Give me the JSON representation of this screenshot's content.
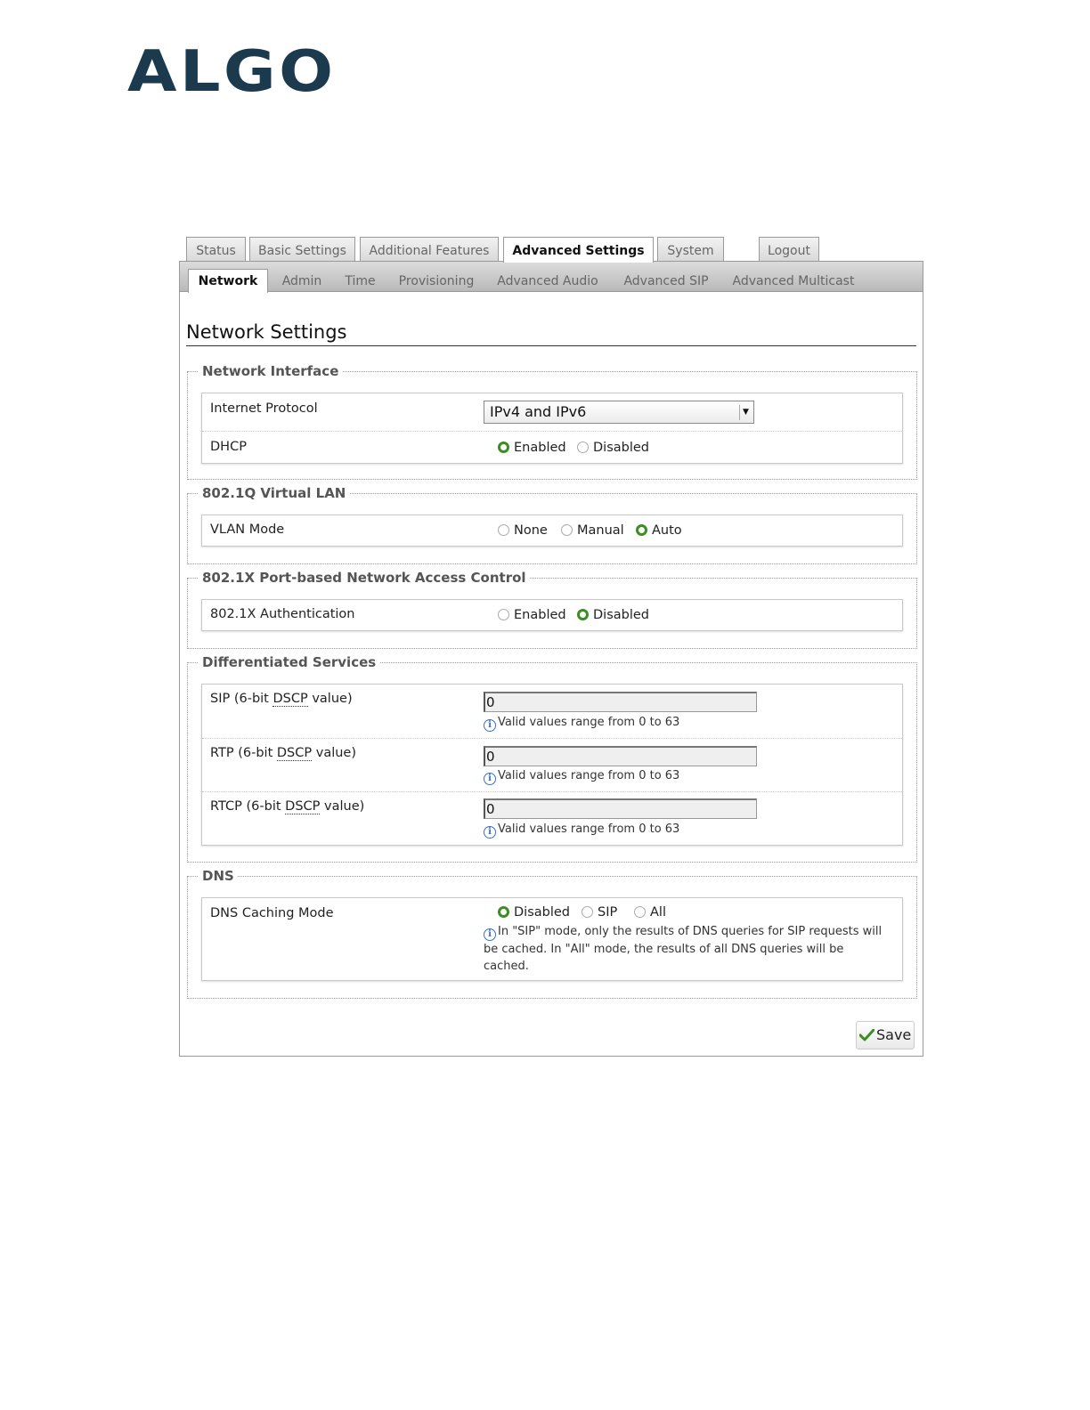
{
  "brand": {
    "logo_text": "ALGO"
  },
  "top_tabs": [
    {
      "label": "Status"
    },
    {
      "label": "Basic Settings"
    },
    {
      "label": "Additional Features"
    },
    {
      "label": "Advanced Settings",
      "active": true
    },
    {
      "label": "System"
    },
    {
      "label": "Logout"
    }
  ],
  "sub_tabs": [
    {
      "label": "Network",
      "active": true
    },
    {
      "label": "Admin"
    },
    {
      "label": "Time"
    },
    {
      "label": "Provisioning"
    },
    {
      "label": "Advanced Audio"
    },
    {
      "label": "Advanced SIP"
    },
    {
      "label": "Advanced Multicast"
    }
  ],
  "page_title": "Network Settings",
  "network_interface": {
    "legend": "Network Interface",
    "internet_protocol": {
      "label": "Internet Protocol",
      "value": "IPv4 and IPv6"
    },
    "dhcp": {
      "label": "DHCP",
      "options": [
        "Enabled",
        "Disabled"
      ],
      "selected": "Enabled"
    }
  },
  "vlan": {
    "legend": "802.1Q Virtual LAN",
    "mode": {
      "label": "VLAN Mode",
      "options": [
        "None",
        "Manual",
        "Auto"
      ],
      "selected": "Auto"
    }
  },
  "port_access": {
    "legend": "802.1X Port-based Network Access Control",
    "auth": {
      "label": "802.1X Authentication",
      "options": [
        "Enabled",
        "Disabled"
      ],
      "selected": "Disabled"
    }
  },
  "diffserv": {
    "legend": "Differentiated Services",
    "dscp_abbr": "DSCP",
    "rows": [
      {
        "prefix": "SIP (6-bit ",
        "suffix": " value)",
        "value": "0",
        "hint": "Valid values range from 0 to 63"
      },
      {
        "prefix": "RTP (6-bit ",
        "suffix": " value)",
        "value": "0",
        "hint": "Valid values range from 0 to 63"
      },
      {
        "prefix": "RTCP (6-bit ",
        "suffix": " value)",
        "value": "0",
        "hint": "Valid values range from 0 to 63"
      }
    ]
  },
  "dns": {
    "legend": "DNS",
    "caching": {
      "label": "DNS Caching Mode",
      "options": [
        "Disabled",
        "SIP",
        "All"
      ],
      "selected": "Disabled",
      "hint": "In \"SIP\" mode, only the results of DNS queries for SIP requests will be cached. In \"All\" mode, the results of all DNS queries will be cached."
    }
  },
  "save_label": "Save",
  "colors": {
    "brand": "#1b3a4e",
    "radio_checked": "#3b8e1f",
    "info_icon": "#3a6fc4",
    "save_check": "#3b8e1f"
  }
}
